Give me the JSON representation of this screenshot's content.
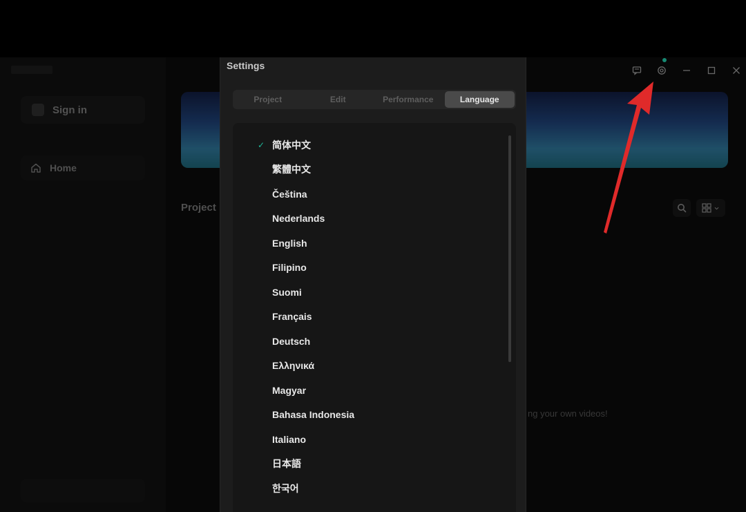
{
  "sidebar": {
    "sign_in": "Sign in",
    "home": "Home"
  },
  "main": {
    "projects_title": "Project",
    "empty_hint": "ng your own videos!"
  },
  "settings": {
    "title": "Settings",
    "tabs": [
      {
        "label": "Project",
        "active": false
      },
      {
        "label": "Edit",
        "active": false
      },
      {
        "label": "Performance",
        "active": false
      },
      {
        "label": "Language",
        "active": true
      }
    ],
    "languages": [
      {
        "label": "简体中文",
        "selected": true
      },
      {
        "label": "繁體中文",
        "selected": false
      },
      {
        "label": "Čeština",
        "selected": false
      },
      {
        "label": "Nederlands",
        "selected": false
      },
      {
        "label": "English",
        "selected": false
      },
      {
        "label": "Filipino",
        "selected": false
      },
      {
        "label": "Suomi",
        "selected": false
      },
      {
        "label": "Français",
        "selected": false
      },
      {
        "label": "Deutsch",
        "selected": false
      },
      {
        "label": "Ελληνικά",
        "selected": false
      },
      {
        "label": "Magyar",
        "selected": false
      },
      {
        "label": "Bahasa Indonesia",
        "selected": false
      },
      {
        "label": "Italiano",
        "selected": false
      },
      {
        "label": "日本語",
        "selected": false
      },
      {
        "label": "한국어",
        "selected": false
      }
    ],
    "check_glyph": "✓"
  },
  "icons": {
    "home": "home-icon",
    "search": "search-icon",
    "view": "grid-view-icon",
    "feedback": "feedback-icon",
    "settings": "gear-icon",
    "minimize": "minimize-icon",
    "maximize": "maximize-icon",
    "close": "close-icon"
  },
  "colors": {
    "accent": "#1fb89a",
    "annotation": "#e02a2a"
  }
}
